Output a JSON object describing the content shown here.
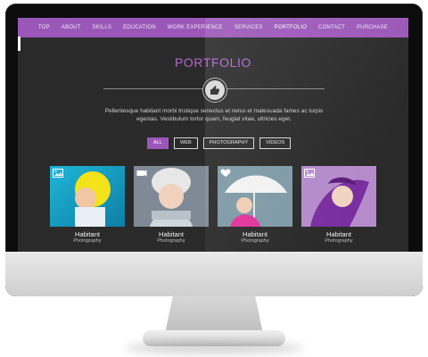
{
  "nav": {
    "items": [
      "TOP",
      "ABOUT",
      "SKILLS",
      "EDUCATION",
      "WORK EXPERIENCE",
      "SERVICES",
      "PORTFOLIO",
      "CONTACT",
      "PURCHASE"
    ],
    "active": "PORTFOLIO",
    "accent_color": "#9b57b8"
  },
  "section": {
    "title": "PORTFOLIO",
    "text": "Pellentesque habitant morbi tristique senectus et netus et malesuada fames ac turpis egestas. Vestibulum tortor quam, feugiat vitae, ultricies eget.",
    "icon": "thumbs-up-icon"
  },
  "filters": {
    "items": [
      "ALL",
      "WEB",
      "PHOTOGRAPHY",
      "VIDEOS"
    ],
    "active": "ALL"
  },
  "portfolio": [
    {
      "label": "Habitant",
      "sub": "Photography",
      "icon": "image-icon"
    },
    {
      "label": "Habitant",
      "sub": "Photography",
      "icon": "video-camera-icon"
    },
    {
      "label": "Habitant",
      "sub": "Photography",
      "icon": "heart-icon"
    },
    {
      "label": "Habitant",
      "sub": "Photography",
      "icon": "image-icon"
    }
  ]
}
